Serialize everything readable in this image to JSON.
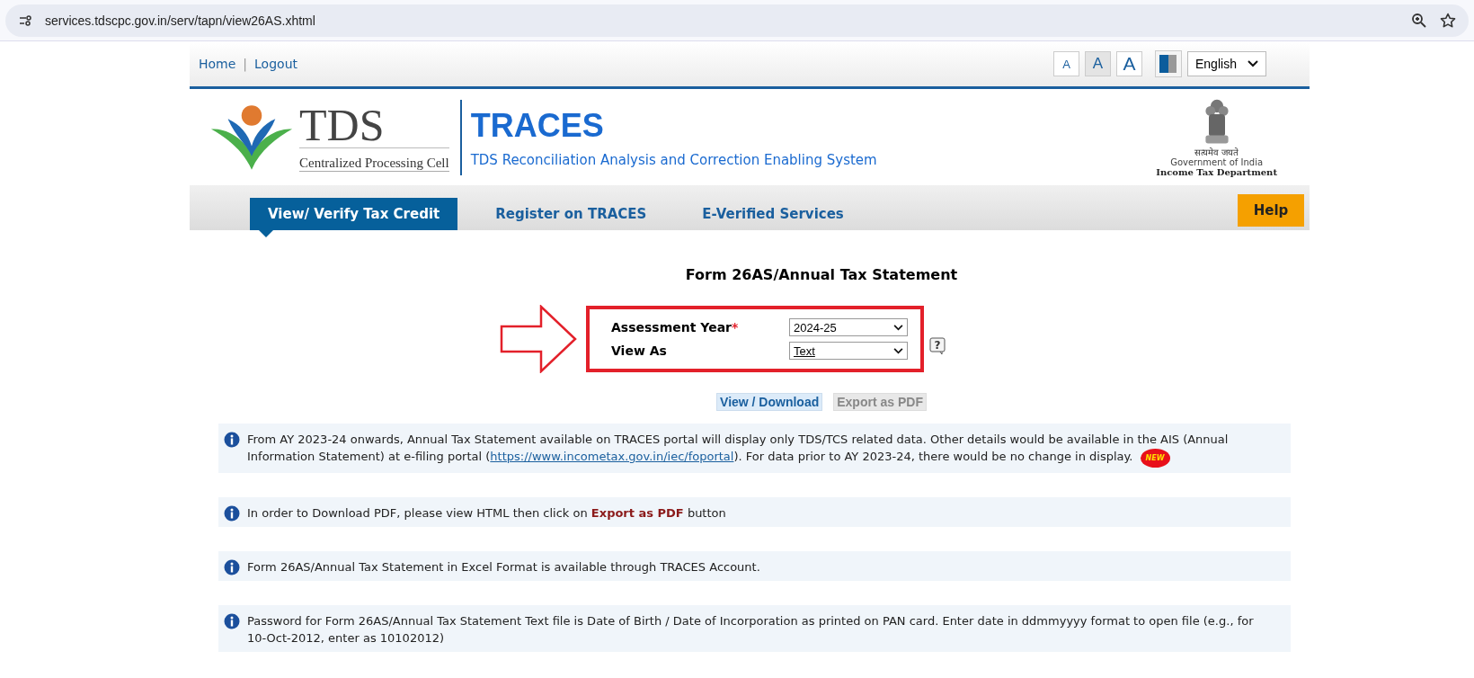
{
  "browser": {
    "url": "services.tdscpc.gov.in/serv/tapn/view26AS.xhtml"
  },
  "top_bar": {
    "links": [
      "Home",
      "Logout"
    ],
    "separator": "|",
    "font_sizes": [
      {
        "label": "A",
        "selected": false
      },
      {
        "label": "A",
        "selected": true
      },
      {
        "label": "A",
        "selected": false
      }
    ],
    "language": "English"
  },
  "header": {
    "logo_text": "TDS",
    "logo_caption": "Centralized Processing Cell",
    "title": "TRACES",
    "subtitle": "TDS Reconciliation Analysis and Correction Enabling System",
    "emblem_motto": "सत्यमेव जयते",
    "emblem_line1": "Government of India",
    "emblem_line2": "Income Tax Department"
  },
  "nav": {
    "tabs": [
      {
        "label": "View/ Verify Tax Credit",
        "selected": true
      },
      {
        "label": "Register on TRACES",
        "selected": false
      },
      {
        "label": "E-Verified Services",
        "selected": false
      }
    ],
    "help": "Help"
  },
  "page_title": "Form 26AS/Annual Tax Statement",
  "form": {
    "help_icon": "?",
    "fields": [
      {
        "label": "Assessment Year",
        "required_mark": "*",
        "value": "2024-25"
      },
      {
        "label": "View As",
        "value": "Text"
      }
    ]
  },
  "buttons": [
    {
      "label": "View / Download",
      "disabled": false
    },
    {
      "label": "Export as PDF",
      "disabled": true
    }
  ],
  "notes": [
    {
      "parts": [
        {
          "kind": "text",
          "text": "From AY 2023-24 onwards, Annual Tax Statement available on TRACES portal will display only TDS/TCS related data. Other details would be available in the AIS (Annual Information Statement) at e-filing portal ("
        },
        {
          "kind": "link",
          "text": "https://www.incometax.gov.in/iec/foportal"
        },
        {
          "kind": "text",
          "text": "). For data prior to AY 2023-24, there would be no change in display. "
        },
        {
          "kind": "badge",
          "text": "NEW"
        }
      ]
    },
    {
      "parts": [
        {
          "kind": "text",
          "text": "In order to Download PDF, please view HTML then click on "
        },
        {
          "kind": "bold",
          "text": "Export as PDF"
        },
        {
          "kind": "text",
          "text": " button"
        }
      ]
    },
    {
      "parts": [
        {
          "kind": "text",
          "text": "Form 26AS/Annual Tax Statement in Excel Format is available through TRACES Account."
        }
      ]
    },
    {
      "parts": [
        {
          "kind": "text",
          "text": "Password for Form 26AS/Annual Tax Statement Text file is Date of Birth / Date of Incorporation as printed on PAN card. Enter date in ddmmyyyy format to open file (e.g., for 10-Oct-2012, enter as 10102012)"
        }
      ]
    }
  ]
}
